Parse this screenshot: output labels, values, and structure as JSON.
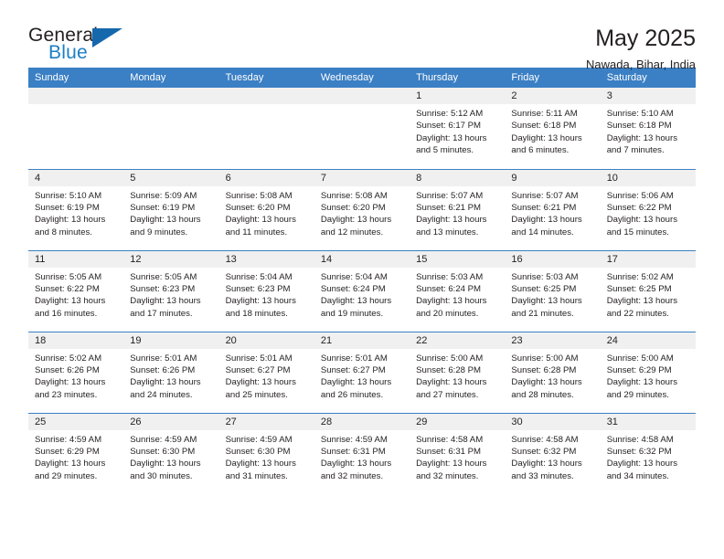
{
  "brand": {
    "name_part1": "General",
    "name_part2": "Blue",
    "logo_icon": "triangle-flag-icon"
  },
  "header": {
    "title": "May 2025",
    "subtitle": "Nawada, Bihar, India"
  },
  "weekday_headers": [
    "Sunday",
    "Monday",
    "Tuesday",
    "Wednesday",
    "Thursday",
    "Friday",
    "Saturday"
  ],
  "labels": {
    "sunrise": "Sunrise:",
    "sunset": "Sunset:",
    "daylight": "Daylight:"
  },
  "colors": {
    "header_blue": "#3b7fc4",
    "brand_blue": "#1c7fc4",
    "logo_blue": "#1668ad",
    "daynum_band": "#f0f0f0",
    "text": "#231f20"
  },
  "weeks": [
    [
      {
        "day": "",
        "empty": true
      },
      {
        "day": "",
        "empty": true
      },
      {
        "day": "",
        "empty": true
      },
      {
        "day": "",
        "empty": true
      },
      {
        "day": "1",
        "sunrise": "Sunrise: 5:12 AM",
        "sunset": "Sunset: 6:17 PM",
        "daylight_line1": "Daylight: 13 hours",
        "daylight_line2": "and 5 minutes."
      },
      {
        "day": "2",
        "sunrise": "Sunrise: 5:11 AM",
        "sunset": "Sunset: 6:18 PM",
        "daylight_line1": "Daylight: 13 hours",
        "daylight_line2": "and 6 minutes."
      },
      {
        "day": "3",
        "sunrise": "Sunrise: 5:10 AM",
        "sunset": "Sunset: 6:18 PM",
        "daylight_line1": "Daylight: 13 hours",
        "daylight_line2": "and 7 minutes."
      }
    ],
    [
      {
        "day": "4",
        "sunrise": "Sunrise: 5:10 AM",
        "sunset": "Sunset: 6:19 PM",
        "daylight_line1": "Daylight: 13 hours",
        "daylight_line2": "and 8 minutes."
      },
      {
        "day": "5",
        "sunrise": "Sunrise: 5:09 AM",
        "sunset": "Sunset: 6:19 PM",
        "daylight_line1": "Daylight: 13 hours",
        "daylight_line2": "and 9 minutes."
      },
      {
        "day": "6",
        "sunrise": "Sunrise: 5:08 AM",
        "sunset": "Sunset: 6:20 PM",
        "daylight_line1": "Daylight: 13 hours",
        "daylight_line2": "and 11 minutes."
      },
      {
        "day": "7",
        "sunrise": "Sunrise: 5:08 AM",
        "sunset": "Sunset: 6:20 PM",
        "daylight_line1": "Daylight: 13 hours",
        "daylight_line2": "and 12 minutes."
      },
      {
        "day": "8",
        "sunrise": "Sunrise: 5:07 AM",
        "sunset": "Sunset: 6:21 PM",
        "daylight_line1": "Daylight: 13 hours",
        "daylight_line2": "and 13 minutes."
      },
      {
        "day": "9",
        "sunrise": "Sunrise: 5:07 AM",
        "sunset": "Sunset: 6:21 PM",
        "daylight_line1": "Daylight: 13 hours",
        "daylight_line2": "and 14 minutes."
      },
      {
        "day": "10",
        "sunrise": "Sunrise: 5:06 AM",
        "sunset": "Sunset: 6:22 PM",
        "daylight_line1": "Daylight: 13 hours",
        "daylight_line2": "and 15 minutes."
      }
    ],
    [
      {
        "day": "11",
        "sunrise": "Sunrise: 5:05 AM",
        "sunset": "Sunset: 6:22 PM",
        "daylight_line1": "Daylight: 13 hours",
        "daylight_line2": "and 16 minutes."
      },
      {
        "day": "12",
        "sunrise": "Sunrise: 5:05 AM",
        "sunset": "Sunset: 6:23 PM",
        "daylight_line1": "Daylight: 13 hours",
        "daylight_line2": "and 17 minutes."
      },
      {
        "day": "13",
        "sunrise": "Sunrise: 5:04 AM",
        "sunset": "Sunset: 6:23 PM",
        "daylight_line1": "Daylight: 13 hours",
        "daylight_line2": "and 18 minutes."
      },
      {
        "day": "14",
        "sunrise": "Sunrise: 5:04 AM",
        "sunset": "Sunset: 6:24 PM",
        "daylight_line1": "Daylight: 13 hours",
        "daylight_line2": "and 19 minutes."
      },
      {
        "day": "15",
        "sunrise": "Sunrise: 5:03 AM",
        "sunset": "Sunset: 6:24 PM",
        "daylight_line1": "Daylight: 13 hours",
        "daylight_line2": "and 20 minutes."
      },
      {
        "day": "16",
        "sunrise": "Sunrise: 5:03 AM",
        "sunset": "Sunset: 6:25 PM",
        "daylight_line1": "Daylight: 13 hours",
        "daylight_line2": "and 21 minutes."
      },
      {
        "day": "17",
        "sunrise": "Sunrise: 5:02 AM",
        "sunset": "Sunset: 6:25 PM",
        "daylight_line1": "Daylight: 13 hours",
        "daylight_line2": "and 22 minutes."
      }
    ],
    [
      {
        "day": "18",
        "sunrise": "Sunrise: 5:02 AM",
        "sunset": "Sunset: 6:26 PM",
        "daylight_line1": "Daylight: 13 hours",
        "daylight_line2": "and 23 minutes."
      },
      {
        "day": "19",
        "sunrise": "Sunrise: 5:01 AM",
        "sunset": "Sunset: 6:26 PM",
        "daylight_line1": "Daylight: 13 hours",
        "daylight_line2": "and 24 minutes."
      },
      {
        "day": "20",
        "sunrise": "Sunrise: 5:01 AM",
        "sunset": "Sunset: 6:27 PM",
        "daylight_line1": "Daylight: 13 hours",
        "daylight_line2": "and 25 minutes."
      },
      {
        "day": "21",
        "sunrise": "Sunrise: 5:01 AM",
        "sunset": "Sunset: 6:27 PM",
        "daylight_line1": "Daylight: 13 hours",
        "daylight_line2": "and 26 minutes."
      },
      {
        "day": "22",
        "sunrise": "Sunrise: 5:00 AM",
        "sunset": "Sunset: 6:28 PM",
        "daylight_line1": "Daylight: 13 hours",
        "daylight_line2": "and 27 minutes."
      },
      {
        "day": "23",
        "sunrise": "Sunrise: 5:00 AM",
        "sunset": "Sunset: 6:28 PM",
        "daylight_line1": "Daylight: 13 hours",
        "daylight_line2": "and 28 minutes."
      },
      {
        "day": "24",
        "sunrise": "Sunrise: 5:00 AM",
        "sunset": "Sunset: 6:29 PM",
        "daylight_line1": "Daylight: 13 hours",
        "daylight_line2": "and 29 minutes."
      }
    ],
    [
      {
        "day": "25",
        "sunrise": "Sunrise: 4:59 AM",
        "sunset": "Sunset: 6:29 PM",
        "daylight_line1": "Daylight: 13 hours",
        "daylight_line2": "and 29 minutes."
      },
      {
        "day": "26",
        "sunrise": "Sunrise: 4:59 AM",
        "sunset": "Sunset: 6:30 PM",
        "daylight_line1": "Daylight: 13 hours",
        "daylight_line2": "and 30 minutes."
      },
      {
        "day": "27",
        "sunrise": "Sunrise: 4:59 AM",
        "sunset": "Sunset: 6:30 PM",
        "daylight_line1": "Daylight: 13 hours",
        "daylight_line2": "and 31 minutes."
      },
      {
        "day": "28",
        "sunrise": "Sunrise: 4:59 AM",
        "sunset": "Sunset: 6:31 PM",
        "daylight_line1": "Daylight: 13 hours",
        "daylight_line2": "and 32 minutes."
      },
      {
        "day": "29",
        "sunrise": "Sunrise: 4:58 AM",
        "sunset": "Sunset: 6:31 PM",
        "daylight_line1": "Daylight: 13 hours",
        "daylight_line2": "and 32 minutes."
      },
      {
        "day": "30",
        "sunrise": "Sunrise: 4:58 AM",
        "sunset": "Sunset: 6:32 PM",
        "daylight_line1": "Daylight: 13 hours",
        "daylight_line2": "and 33 minutes."
      },
      {
        "day": "31",
        "sunrise": "Sunrise: 4:58 AM",
        "sunset": "Sunset: 6:32 PM",
        "daylight_line1": "Daylight: 13 hours",
        "daylight_line2": "and 34 minutes."
      }
    ]
  ]
}
